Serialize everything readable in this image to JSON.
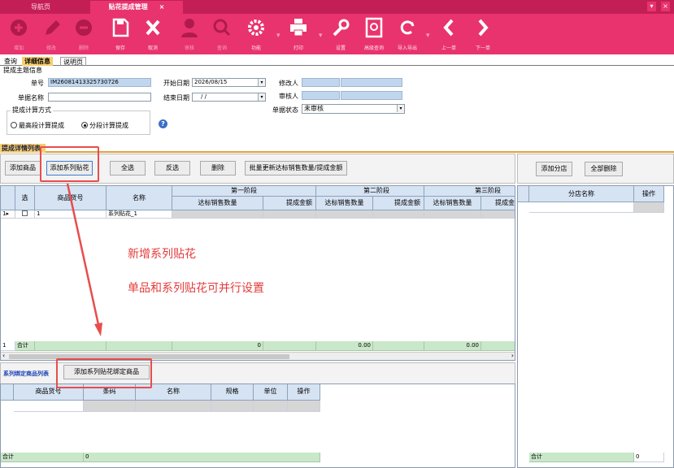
{
  "tabs": {
    "nav": "导航页",
    "active": "贴花提成管理",
    "close": "×"
  },
  "window_buttons": {
    "menu": "▾",
    "close": "×"
  },
  "toolbar": {
    "add": "增加",
    "edit": "修改",
    "delete": "删除",
    "save": "保存",
    "cancel": "取消",
    "audit": "审核",
    "query": "查询",
    "function": "功能",
    "print": "打印",
    "settings": "设置",
    "advanced_query": "高级查询",
    "import_export": "导入导出",
    "prev": "上一单",
    "next": "下一单"
  },
  "subtabs": {
    "query": "查询",
    "detail": "详细信息",
    "help": "说明页"
  },
  "form": {
    "section_title": "提成主题信息",
    "doc_no_label": "单号",
    "doc_no_value": "IM26081413325730726",
    "doc_name_label": "单据名称",
    "doc_name_value": "",
    "start_date_label": "开始日期",
    "start_date_value": "2026/08/15",
    "end_date_label": "结束日期",
    "end_date_value": "/ /",
    "modifier_label": "修改人",
    "auditor_label": "审核人",
    "status_label": "单据状态",
    "status_value": "未审核",
    "calc_method_label": "提成计算方式",
    "radio_highest": "最高段计算提成",
    "radio_segment": "分段计算提成",
    "help_icon": "?"
  },
  "detail_section": {
    "title": "提成详情列表"
  },
  "buttons": {
    "add_product": "添加商品",
    "add_series": "添加系列贴花",
    "select_all": "全选",
    "invert": "反选",
    "delete": "删除",
    "batch_update": "批量更新达标销售数量/提成金额",
    "add_store": "添加分店",
    "delete_all": "全部删除",
    "bind_series": "添加系列贴花绑定商品"
  },
  "main_grid": {
    "col_select": "选",
    "col_code": "商品货号",
    "col_name": "名称",
    "stage1": "第一阶段",
    "stage2": "第二阶段",
    "stage3": "第三阶段",
    "sub_qty": "达标销售数量",
    "sub_amt": "提成金额",
    "sub_amt_trunc": "提成金",
    "row1": {
      "num": "1",
      "code": "1",
      "name": "系列贴花_1"
    },
    "footer": {
      "num": "1",
      "label": "合计",
      "v1": "0",
      "v2": "0.00",
      "v3": "0.00"
    }
  },
  "store_grid": {
    "col_store": "分店名称",
    "col_op": "操作",
    "footer_label": "合计",
    "footer_val": "0"
  },
  "bind_section": {
    "title": "系列绑定商品列表"
  },
  "bind_grid": {
    "col_code": "商品货号",
    "col_barcode": "条码",
    "col_name": "名称",
    "col_spec": "规格",
    "col_unit": "单位",
    "col_op": "操作",
    "footer_label": "合计",
    "footer_val": "0"
  },
  "annotations": {
    "line1": "新增系列贴花",
    "line2": "单品和系列贴花可并行设置"
  },
  "colors": {
    "brand": "#e8336f",
    "tabbar": "#c41e57",
    "annotation": "#e84d4d",
    "section": "#f6cf6f"
  }
}
